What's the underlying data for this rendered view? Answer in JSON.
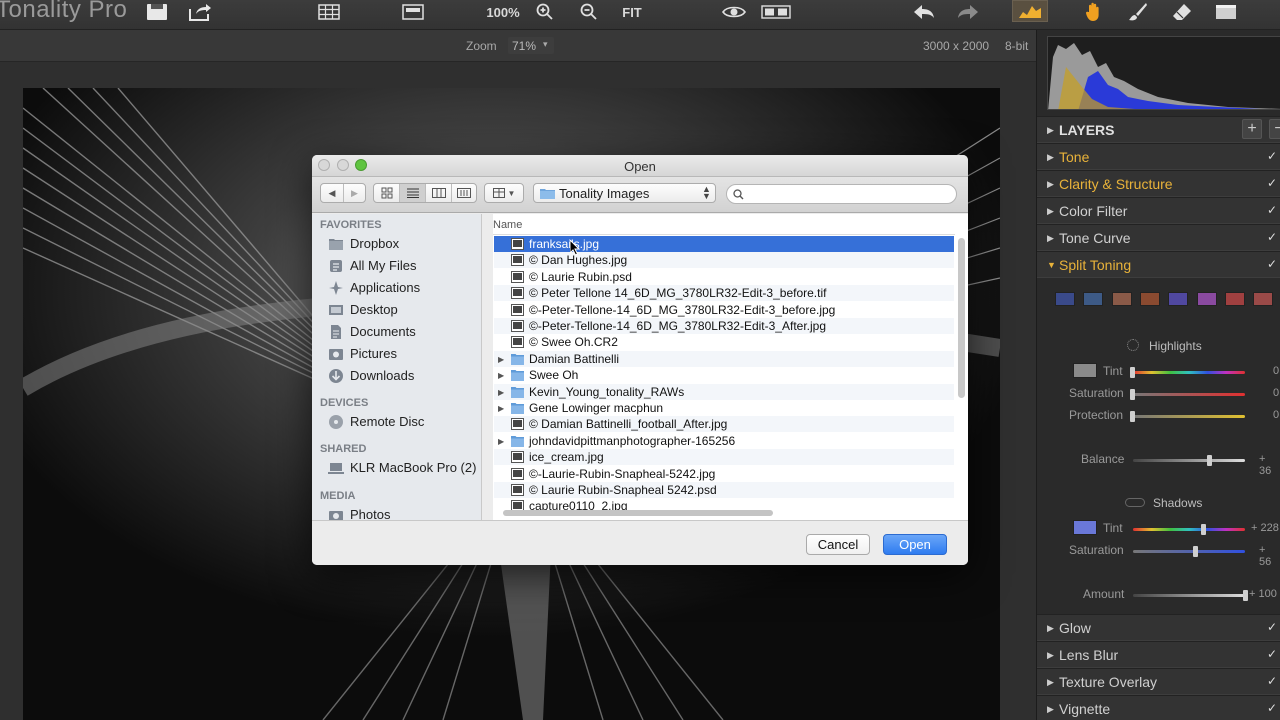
{
  "app": {
    "title": "Tonality Pro"
  },
  "toolbar": {
    "zoom_100_label": "100%",
    "fit_label": "FIT",
    "icons": [
      "save-icon",
      "share-icon",
      "grid-view-icon",
      "single-view-icon",
      "zoom-in-icon",
      "zoom-out-icon",
      "eye-icon",
      "compare-icon",
      "undo-icon",
      "redo-icon",
      "histogram-mode-icon",
      "hand-tool-icon",
      "brush-tool-icon",
      "eraser-tool-icon",
      "panel-icon"
    ]
  },
  "subbar": {
    "zoom_label": "Zoom",
    "zoom_value": "71%",
    "dimensions": "3000 x 2000",
    "bit_depth": "8-bit"
  },
  "panel": {
    "layers_label": "LAYERS",
    "sections_top": [
      {
        "label": "Tone",
        "accent": true,
        "checked": "✓"
      },
      {
        "label": "Clarity & Structure",
        "accent": true,
        "checked": "✓"
      },
      {
        "label": "Color Filter",
        "accent": false,
        "checked": "✓"
      },
      {
        "label": "Tone Curve",
        "accent": false,
        "checked": "✓"
      },
      {
        "label": "Split Toning",
        "accent": true,
        "checked": "✓"
      }
    ],
    "swatch_colors": [
      "#3a4a8a",
      "#3d5a86",
      "#8a5a48",
      "#8a4a30",
      "#5048a0",
      "#8a4aa0",
      "#a04040",
      "#9a4a48"
    ],
    "highlights": {
      "title": "Highlights",
      "tint_label": "Tint",
      "tint_color": "#8a8a8a",
      "tint_value": "0",
      "saturation_label": "Saturation",
      "saturation_value": "0",
      "protection_label": "Protection",
      "protection_value": "0"
    },
    "balance_label": "Balance",
    "balance_value": "+ 36",
    "shadows": {
      "title": "Shadows",
      "tint_label": "Tint",
      "tint_color": "#6a78d8",
      "tint_value": "+ 228",
      "saturation_label": "Saturation",
      "saturation_value": "+ 56"
    },
    "amount_label": "Amount",
    "amount_value": "+ 100",
    "sections_bottom": [
      {
        "label": "Glow",
        "checked": "✓"
      },
      {
        "label": "Lens Blur",
        "checked": "✓"
      },
      {
        "label": "Texture Overlay",
        "checked": "✓"
      },
      {
        "label": "Vignette",
        "checked": "✓"
      }
    ]
  },
  "dialog": {
    "title": "Open",
    "location": "Tonality Images",
    "search_placeholder": "",
    "column_name": "Name",
    "sidebar": {
      "favorites_heading": "FAVORITES",
      "favorites": [
        "Dropbox",
        "All My Files",
        "Applications",
        "Desktop",
        "Documents",
        "Pictures",
        "Downloads"
      ],
      "devices_heading": "DEVICES",
      "devices": [
        "Remote Disc"
      ],
      "shared_heading": "SHARED",
      "shared": [
        "KLR MacBook Pro (2)"
      ],
      "media_heading": "MEDIA",
      "media": [
        "Photos"
      ]
    },
    "files": [
      {
        "name": "franksails.jpg",
        "type": "image",
        "folder": false,
        "selected": true
      },
      {
        "name": "© Dan Hughes.jpg",
        "type": "image",
        "folder": false,
        "selected": false
      },
      {
        "name": " © Laurie Rubin.psd",
        "type": "image",
        "folder": false,
        "selected": false
      },
      {
        "name": "© Peter Tellone 14_6D_MG_3780LR32-Edit-3_before.tif",
        "type": "image",
        "folder": false,
        "selected": false
      },
      {
        "name": "©-Peter-Tellone-14_6D_MG_3780LR32-Edit-3_before.jpg",
        "type": "image",
        "folder": false,
        "selected": false
      },
      {
        "name": "©-Peter-Tellone-14_6D_MG_3780LR32-Edit-3_After.jpg",
        "type": "image",
        "folder": false,
        "selected": false
      },
      {
        "name": "© Swee Oh.CR2",
        "type": "image",
        "folder": false,
        "selected": false
      },
      {
        "name": "Damian Battinelli",
        "type": "folder",
        "folder": true,
        "selected": false
      },
      {
        "name": "Swee Oh",
        "type": "folder",
        "folder": true,
        "selected": false
      },
      {
        "name": "Kevin_Young_tonality_RAWs",
        "type": "folder",
        "folder": true,
        "selected": false
      },
      {
        "name": "Gene Lowinger macphun",
        "type": "folder",
        "folder": true,
        "selected": false
      },
      {
        "name": "© Damian Battinelli_football_After.jpg",
        "type": "image",
        "folder": false,
        "selected": false
      },
      {
        "name": "johndavidpittmanphotographer-165256",
        "type": "folder",
        "folder": true,
        "selected": false
      },
      {
        "name": "ice_cream.jpg",
        "type": "image",
        "folder": false,
        "selected": false
      },
      {
        "name": "©-Laurie-Rubin-Snapheal-5242.jpg",
        "type": "image",
        "folder": false,
        "selected": false
      },
      {
        "name": "© Laurie Rubin-Snapheal 5242.psd",
        "type": "image",
        "folder": false,
        "selected": false
      },
      {
        "name": "capture0110_2.jpg",
        "type": "image",
        "folder": false,
        "selected": false
      }
    ],
    "cancel_label": "Cancel",
    "open_label": "Open"
  }
}
